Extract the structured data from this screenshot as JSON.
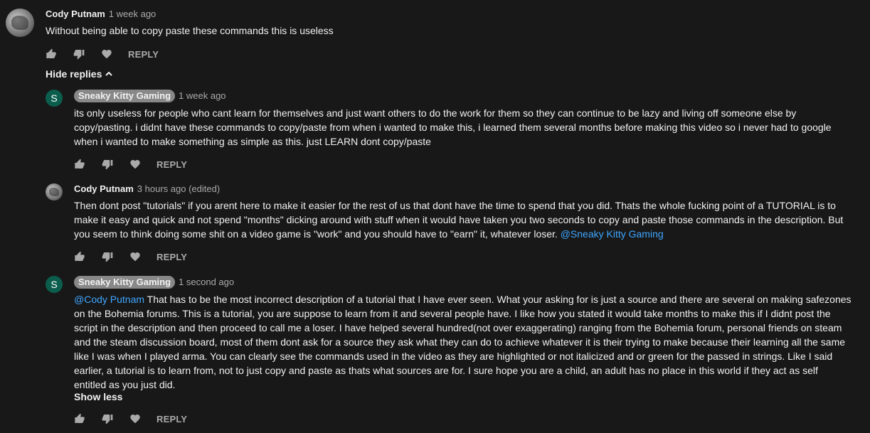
{
  "comments": [
    {
      "author": "Cody Putnam",
      "time": "1 week ago",
      "text": "Without being able to copy paste these commands this is useless",
      "reply_label": "REPLY"
    }
  ],
  "hide_replies_label": "Hide replies",
  "replies": [
    {
      "avatar_letter": "S",
      "author": "Sneaky Kitty Gaming",
      "time": "1 week ago",
      "lines": [
        "its only useless for people who cant learn for themselves and just want others to do the work for them so they can continue to be lazy and living off someone else by",
        "copy/pasting. i didnt have these commands to copy/paste from when i wanted to make this, i learned them several months before making this video so i never had to google",
        "when i wanted to make something as simple as this. just LEARN dont copy/paste"
      ],
      "reply_label": "REPLY"
    },
    {
      "author": "Cody Putnam",
      "time": "3 hours ago (edited)",
      "lines": [
        "Then dont post \"tutorials\" if you arent here to make it easier for the rest of us that dont have the time to spend that you did. Thats the whole fucking point of a TUTORIAL is to",
        "make it easy and quick and not spend \"months\" dicking around with stuff when it would have taken you two seconds to copy and paste those commands in the description. But",
        "you seem to think doing some shit on a video game is \"work\" and you should have to \"earn\" it, whatever loser. "
      ],
      "mention": "@Sneaky Kitty Gaming",
      "reply_label": "REPLY"
    },
    {
      "avatar_letter": "S",
      "author": "Sneaky Kitty Gaming",
      "time": "1 second ago",
      "mention": "@Cody Putnam",
      "first_line_rest": " That has to be the most incorrect description of a tutorial that I have ever seen. What your asking for is just a source and there are several on making safezones",
      "lines": [
        "on the Bohemia forums. This is a tutorial, you are suppose to learn from it and several people have. I like how you stated it would take months to make this if I didnt post the",
        "script in the description and then proceed to call me a loser. I have helped several hundred(not over exaggerating) ranging from the Bohemia forum, personal friends on steam",
        "and the steam discussion board, most of them dont ask for a source they ask what they can do to achieve whatever it is their trying to make because their learning all the same",
        "like I was when I played arma. You can clearly see the commands used in the video as they are highlighted or not italicized and or green for the passed in strings. Like I said",
        "earlier, a tutorial is to learn from, not to just copy and paste as thats what sources are for. I sure hope you are a child, an adult has no place in this world if they act as self",
        "entitled as you just did."
      ],
      "show_less_label": "Show less",
      "reply_label": "REPLY"
    }
  ],
  "icons": [
    "thumbs-up-icon",
    "thumbs-down-icon",
    "heart-icon",
    "chevron-up-icon"
  ],
  "colors": {
    "background": "#181818",
    "text": "#f1f1f1",
    "secondary": "#aaaaaa",
    "link": "#3ea6ff",
    "avatar_letter_bg": "#0b5e4d",
    "badge_bg": "#888888"
  }
}
